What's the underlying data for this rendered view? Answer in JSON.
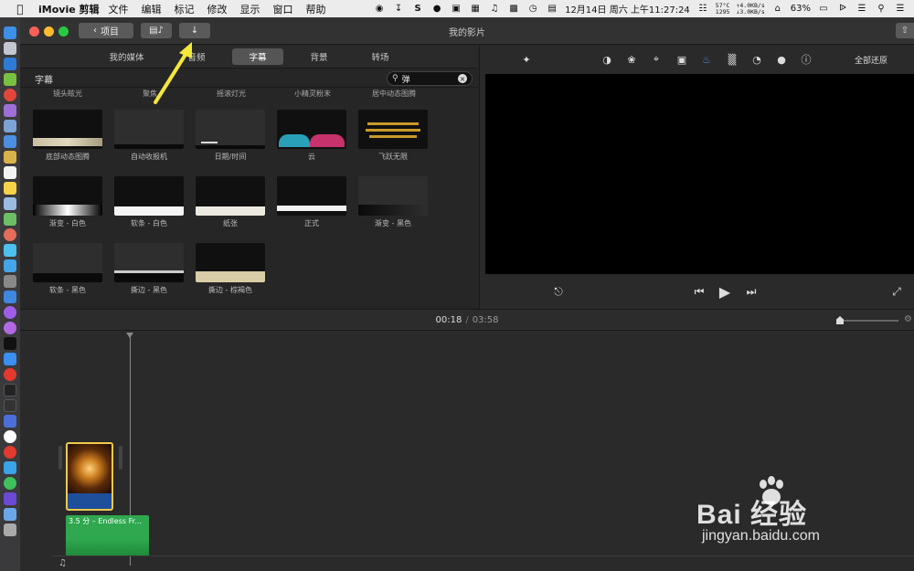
{
  "menubar": {
    "app_name": "iMovie 剪辑",
    "menus": [
      "文件",
      "编辑",
      "标记",
      "修改",
      "显示",
      "窗口",
      "帮助"
    ],
    "temp_line1": "57°C",
    "temp_line2": "1295",
    "net_up": "↑4.0KB/s",
    "net_down": "↓3.0KB/s",
    "datetime": "12月14日 周六 上午11:27:24",
    "battery": "63%",
    "s_icon": "S"
  },
  "titlebar": {
    "projects_label": "项目",
    "window_title": "我的影片"
  },
  "browser": {
    "tabs": [
      "我的媒体",
      "音频",
      "字幕",
      "背景",
      "转场"
    ],
    "active_tab": "字幕",
    "section_label": "字幕",
    "search_value": "弹",
    "top_labels": [
      "镜头眩光",
      "聚焦",
      "摇滚灯光",
      "小精灵粉末",
      "居中动态图腾"
    ],
    "titles": [
      {
        "label": "底部动态图腾"
      },
      {
        "label": "自动收报机"
      },
      {
        "label": "日期/时间"
      },
      {
        "label": "云"
      },
      {
        "label": "飞跃无限"
      },
      {
        "label": "渐变 - 白色"
      },
      {
        "label": "软条 - 白色"
      },
      {
        "label": "纸张"
      },
      {
        "label": "正式"
      },
      {
        "label": "渐变 - 黑色"
      },
      {
        "label": "软条 - 黑色"
      },
      {
        "label": "撕边 - 黑色"
      },
      {
        "label": "撕边 - 棕褐色"
      }
    ]
  },
  "viewer": {
    "reset_all": "全部还原",
    "adjust_icons": [
      "magic-wand-icon",
      "color-balance-icon",
      "color-palette-icon",
      "crop-icon",
      "stabilization-icon",
      "volume-icon",
      "equalizer-icon",
      "speed-icon",
      "filter-icon",
      "info-icon"
    ]
  },
  "timeline": {
    "current_time": "00:18",
    "separator": "/",
    "total_time": "03:58",
    "audio_clip_label": "3.5 分 – Endless Fr..."
  },
  "watermark": {
    "brand": "Bai 经验",
    "url": "jingyan.baidu.com"
  },
  "colors": {
    "accent_blue": "#4a90e2",
    "clip_border": "#f2c94c",
    "audio_green": "#2fa84f",
    "annotation_arrow": "#f4e83a"
  }
}
